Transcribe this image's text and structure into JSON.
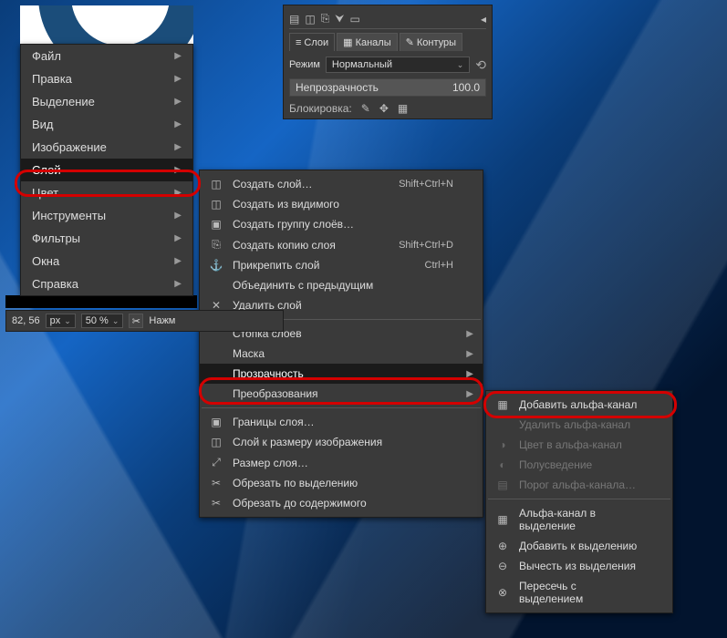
{
  "dock": {
    "tabs": [
      "Слои",
      "Каналы",
      "Контуры"
    ],
    "mode_label": "Режим",
    "mode_value": "Нормальный",
    "opacity_label": "Непрозрачность",
    "opacity_value": "100.0",
    "lock_label": "Блокировка:"
  },
  "main_menu": {
    "items": [
      {
        "label": "Файл",
        "sub": true
      },
      {
        "label": "Правка",
        "sub": true
      },
      {
        "label": "Выделение",
        "sub": true
      },
      {
        "label": "Вид",
        "sub": true
      },
      {
        "label": "Изображение",
        "sub": true
      },
      {
        "label": "Слой",
        "sub": true,
        "selected": true
      },
      {
        "label": "Цвет",
        "sub": true
      },
      {
        "label": "Инструменты",
        "sub": true
      },
      {
        "label": "Фильтры",
        "sub": true
      },
      {
        "label": "Окна",
        "sub": true
      },
      {
        "label": "Справка",
        "sub": true
      }
    ]
  },
  "layer_menu": {
    "g1": [
      {
        "icon": "◫",
        "label": "Создать слой…",
        "accel": "Shift+Ctrl+N"
      },
      {
        "icon": "◫",
        "label": "Создать из видимого",
        "accel": ""
      },
      {
        "icon": "▣",
        "label": "Создать группу слоёв…",
        "accel": ""
      },
      {
        "icon": "⎘",
        "label": "Создать копию слоя",
        "accel": "Shift+Ctrl+D"
      },
      {
        "icon": "⚓",
        "label": "Прикрепить слой",
        "accel": "Ctrl+H"
      },
      {
        "icon": "",
        "label": "Объединить с предыдущим",
        "accel": ""
      },
      {
        "icon": "✕",
        "label": "Удалить слой",
        "accel": ""
      }
    ],
    "g2": [
      {
        "label": "Стопка слоев",
        "sub": true
      },
      {
        "label": "Маска",
        "sub": true
      },
      {
        "label": "Прозрачность",
        "sub": true,
        "selected": true
      },
      {
        "label": "Преобразования",
        "sub": true
      }
    ],
    "g3": [
      {
        "icon": "▣",
        "label": "Границы слоя…"
      },
      {
        "icon": "◫",
        "label": "Слой к размеру изображения"
      },
      {
        "icon": "⤢",
        "label": "Размер слоя…"
      },
      {
        "icon": "✂",
        "label": "Обрезать по выделению"
      },
      {
        "icon": "✂",
        "label": "Обрезать до содержимого"
      }
    ]
  },
  "transp_menu": {
    "g1": [
      {
        "icon": "▦",
        "label": "Добавить альфа-канал",
        "disabled": false
      },
      {
        "icon": "",
        "label": "Удалить альфа-канал",
        "disabled": true
      },
      {
        "icon": "◑",
        "label": "Цвет в альфа-канал",
        "disabled": true
      },
      {
        "icon": "◐",
        "label": "Полусведение",
        "disabled": true
      },
      {
        "icon": "▤",
        "label": "Порог альфа-канала…",
        "disabled": true
      }
    ],
    "g2": [
      {
        "icon": "▦",
        "label": "Альфа-канал в выделение"
      },
      {
        "icon": "⊕",
        "label": "Добавить к выделению"
      },
      {
        "icon": "⊖",
        "label": "Вычесть из выделения"
      },
      {
        "icon": "⊗",
        "label": "Пересечь с выделением"
      }
    ]
  },
  "status": {
    "coords": "82, 56",
    "unit": "px",
    "zoom": "50 %",
    "hint": "Нажм"
  }
}
